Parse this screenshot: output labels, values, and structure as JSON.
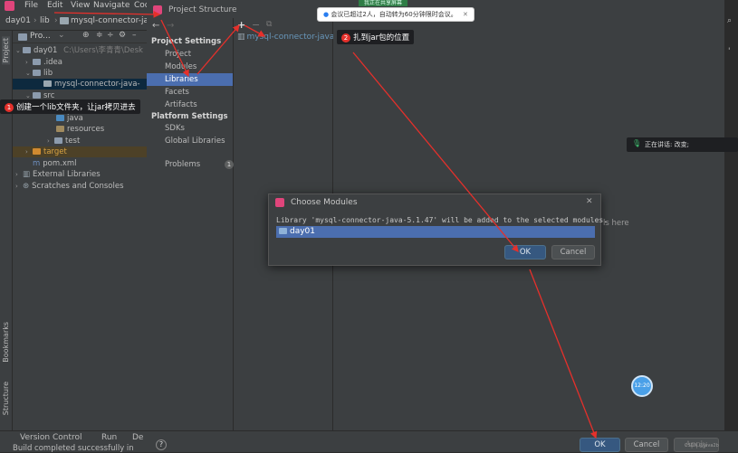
{
  "menubar": {
    "items": [
      "File",
      "Edit",
      "View",
      "Navigate",
      "Cod"
    ]
  },
  "breadcrumb": {
    "project": "day01",
    "folder": "lib",
    "file": "mysql-connector-ja"
  },
  "project_panel": {
    "title": "Pro...",
    "tree": [
      {
        "label": "day01",
        "extra": "C:\\Users\\李青青\\Desk",
        "arrow": "⌄",
        "depth": 0
      },
      {
        "label": ".idea",
        "arrow": "›",
        "depth": 1
      },
      {
        "label": "lib",
        "arrow": "⌄",
        "depth": 1
      },
      {
        "label": "mysql-connector-java-",
        "arrow": "",
        "depth": 2
      },
      {
        "label": "src",
        "arrow": "⌄",
        "depth": 1
      },
      {
        "label": "java",
        "arrow": "",
        "depth": 3
      },
      {
        "label": "resources",
        "arrow": "",
        "depth": 3
      },
      {
        "label": "test",
        "arrow": "›",
        "depth": 2
      },
      {
        "label": "target",
        "arrow": "›",
        "depth": 1
      },
      {
        "label": "pom.xml",
        "arrow": "",
        "depth": 1
      },
      {
        "label": "External Libraries",
        "arrow": "›",
        "depth": 0
      },
      {
        "label": "Scratches and Consoles",
        "arrow": "›",
        "depth": 0
      }
    ]
  },
  "left_stripe": {
    "project_tab": "Project",
    "bookmarks_tab": "Bookmarks",
    "structure_tab": "Structure"
  },
  "project_structure": {
    "title": "Project Structure",
    "project_settings_head": "Project Settings",
    "project_settings": [
      "Project",
      "Modules",
      "Libraries",
      "Facets",
      "Artifacts"
    ],
    "platform_settings_head": "Platform Settings",
    "platform_settings": [
      "SDKs",
      "Global Libraries"
    ],
    "problems": "Problems",
    "problems_count": "1",
    "library_entry": "mysql-connector-java",
    "content_partial": "ls here"
  },
  "choose_modules": {
    "title": "Choose Modules",
    "message": "Library 'mysql-connector-java-5.1.47' will be added to the selected modules.",
    "module": "day01",
    "ok": "OK",
    "cancel": "Cancel"
  },
  "bottom": {
    "version_control": "Version Control",
    "run": "Run",
    "debug": "De",
    "status": "Build completed successfully in",
    "ok": "OK",
    "cancel": "Cancel",
    "apply": "Apply"
  },
  "annotations": {
    "step1_number": "1",
    "step1": "创建一个lib文件夹，让jar拷贝进去",
    "step2_number": "2",
    "step2": "扎到jar包的位置",
    "meeting_banner": "会议已超过2人，自动转为60分钟限时会议。",
    "top_banner": "我正在共享屏幕",
    "speaking": "正在讲话:  改变;",
    "avatar_text": "12:20",
    "watermark": "CSDN @Java2b"
  },
  "colors": {
    "selection": "#4b6eaf",
    "library_selected_text": "#6897bb",
    "ok_button": "#365880",
    "annotation_red": "#e5302b"
  }
}
